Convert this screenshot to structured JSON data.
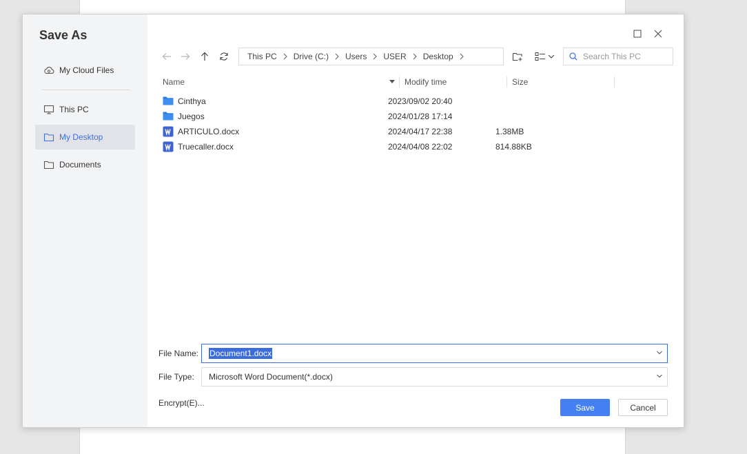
{
  "dialog": {
    "title": "Save As"
  },
  "sidebar": {
    "items": [
      {
        "label": "My Cloud Files",
        "icon": "cloud-icon"
      },
      {
        "label": "This PC",
        "icon": "monitor-icon"
      },
      {
        "label": "My Desktop",
        "icon": "folder-icon",
        "active": true
      },
      {
        "label": "Documents",
        "icon": "folder-icon"
      }
    ]
  },
  "breadcrumb": [
    "This PC",
    "Drive (C:)",
    "Users",
    "USER",
    "Desktop"
  ],
  "search": {
    "placeholder": "Search This PC"
  },
  "columns": {
    "name": "Name",
    "modify_time": "Modify time",
    "size": "Size"
  },
  "files": [
    {
      "name": "Cinthya",
      "type": "folder",
      "modified": "2023/09/02 20:40",
      "size": ""
    },
    {
      "name": "Juegos",
      "type": "folder",
      "modified": "2024/01/28 17:14",
      "size": ""
    },
    {
      "name": "ARTICULO.docx",
      "type": "word",
      "modified": "2024/04/17 22:38",
      "size": "1.38MB"
    },
    {
      "name": "Truecaller.docx",
      "type": "word",
      "modified": "2024/04/08 22:02",
      "size": "814.88KB"
    }
  ],
  "form": {
    "file_name_label": "File Name:",
    "file_name_value": "Document1.docx",
    "file_type_label": "File Type:",
    "file_type_value": "Microsoft Word Document(*.docx)",
    "encrypt_label": "Encrypt(E)...",
    "save_label": "Save",
    "cancel_label": "Cancel"
  },
  "colors": {
    "accent": "#4480f2",
    "folder": "#2f7de1",
    "word_icon": "#3f63d1",
    "sidebar_bg": "#f3f4f6"
  }
}
